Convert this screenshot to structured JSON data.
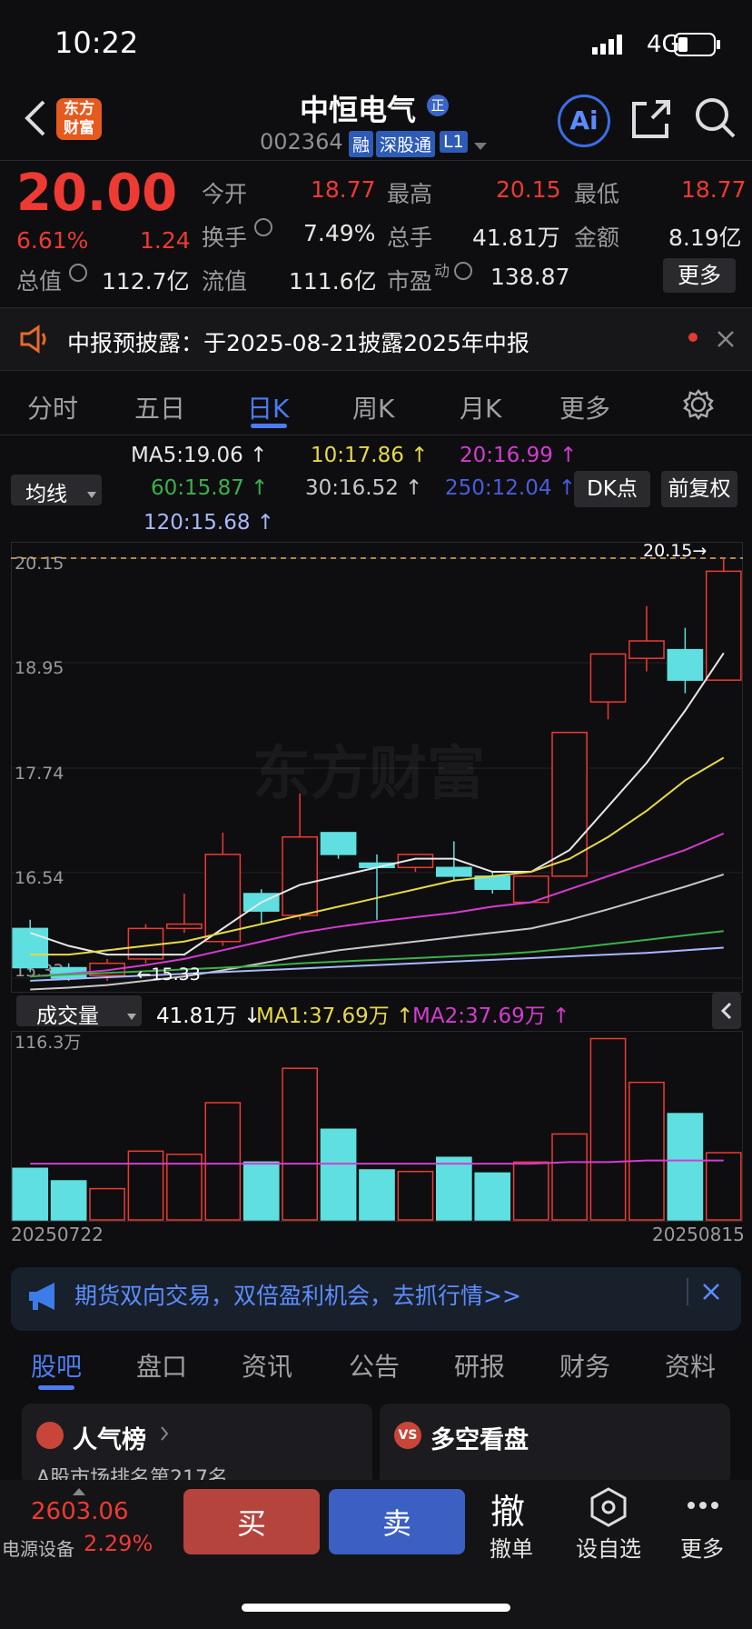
{
  "status": {
    "time": "10:22",
    "network": "4G"
  },
  "header": {
    "logo_text": "东方财富",
    "name": "中恒电气",
    "name_badge": "正",
    "code": "002364",
    "tags": [
      "融",
      "深股通",
      "L1"
    ],
    "ai_label": "Ai"
  },
  "quote": {
    "price": "20.00",
    "change_pct": "6.61%",
    "change_amt": "1.24",
    "rows": [
      [
        {
          "label": "今开",
          "value": "18.77"
        },
        {
          "label": "最高",
          "value": "20.15"
        },
        {
          "label": "最低",
          "value": "18.77"
        }
      ],
      [
        {
          "label": "换手",
          "value": "7.49%"
        },
        {
          "label": "总手",
          "value": "41.81万"
        },
        {
          "label": "金额",
          "value": "8.19亿"
        }
      ],
      [
        {
          "label": "总值",
          "value": "112.7亿"
        },
        {
          "label": "流值",
          "value": "111.6亿"
        },
        {
          "label": "市盈",
          "value": "138.87",
          "sup": "动"
        }
      ]
    ],
    "more_label": "更多"
  },
  "notice": {
    "text": "中报预披露：于2025-08-21披露2025年中报"
  },
  "ktabs": [
    "分时",
    "五日",
    "日K",
    "周K",
    "月K",
    "更多"
  ],
  "ktabs_active": 2,
  "ma": {
    "selector": "均线",
    "items": [
      {
        "label": "MA5:19.06 ↑",
        "color": "#e8e8e8"
      },
      {
        "label": "10:17.86 ↑",
        "color": "#e8d84a"
      },
      {
        "label": "20:16.99 ↑",
        "color": "#d43cd0"
      },
      {
        "label": "60:15.87 ↑",
        "color": "#3cb04a"
      },
      {
        "label": "30:16.52 ↑",
        "color": "#c8c8c8"
      },
      {
        "label": "250:12.04 ↑",
        "color": "#4a5ce0"
      },
      {
        "label": "120:15.68 ↑",
        "color": "#a9b8ff"
      }
    ],
    "dk_label": "DK点",
    "adj_label": "前复权"
  },
  "chart_data": {
    "type": "candlestick",
    "y_ticks": [
      "20.15",
      "18.95",
      "17.74",
      "16.54",
      "15.33"
    ],
    "ylim": [
      15.33,
      20.15
    ],
    "high_marker": "20.15",
    "low_marker": "15.33",
    "watermark": "东方财富",
    "candles": [
      {
        "o": 15.9,
        "c": 15.45,
        "h": 16.0,
        "l": 15.4
      },
      {
        "o": 15.45,
        "c": 15.33,
        "h": 15.5,
        "l": 15.3
      },
      {
        "o": 15.36,
        "c": 15.5,
        "h": 15.55,
        "l": 15.3
      },
      {
        "o": 15.55,
        "c": 15.9,
        "h": 15.95,
        "l": 15.5
      },
      {
        "o": 15.9,
        "c": 15.95,
        "h": 16.3,
        "l": 15.85
      },
      {
        "o": 15.75,
        "c": 16.75,
        "h": 17.0,
        "l": 15.7
      },
      {
        "o": 16.3,
        "c": 16.1,
        "h": 16.35,
        "l": 15.95
      },
      {
        "o": 16.05,
        "c": 16.95,
        "h": 17.45,
        "l": 16.0
      },
      {
        "o": 17.0,
        "c": 16.75,
        "h": 17.0,
        "l": 16.7
      },
      {
        "o": 16.65,
        "c": 16.6,
        "h": 16.75,
        "l": 16.0
      },
      {
        "o": 16.6,
        "c": 16.75,
        "h": 16.75,
        "l": 16.55
      },
      {
        "o": 16.6,
        "c": 16.5,
        "h": 16.9,
        "l": 16.45
      },
      {
        "o": 16.5,
        "c": 16.35,
        "h": 16.55,
        "l": 16.3
      },
      {
        "o": 16.2,
        "c": 16.5,
        "h": 16.5,
        "l": 16.2
      },
      {
        "o": 16.5,
        "c": 18.15,
        "h": 18.15,
        "l": 16.5
      },
      {
        "o": 18.5,
        "c": 19.05,
        "h": 19.05,
        "l": 18.3
      },
      {
        "o": 19.0,
        "c": 19.2,
        "h": 19.6,
        "l": 18.85
      },
      {
        "o": 19.1,
        "c": 18.75,
        "h": 19.35,
        "l": 18.6
      },
      {
        "o": 18.75,
        "c": 20.0,
        "h": 20.15,
        "l": 18.75
      }
    ],
    "ma_lines": {
      "MA5": {
        "color": "#e8e8e8",
        "values": [
          15.85,
          15.7,
          15.6,
          15.6,
          15.6,
          15.9,
          16.2,
          16.4,
          16.5,
          16.6,
          16.7,
          16.7,
          16.55,
          16.55,
          16.8,
          17.3,
          17.8,
          18.4,
          19.06
        ]
      },
      "MA10": {
        "color": "#e8d84a",
        "values": [
          15.6,
          15.6,
          15.65,
          15.7,
          15.75,
          15.85,
          15.95,
          16.05,
          16.15,
          16.25,
          16.35,
          16.45,
          16.5,
          16.55,
          16.7,
          16.95,
          17.25,
          17.6,
          17.86
        ]
      },
      "MA20": {
        "color": "#d43cd0",
        "values": [
          15.35,
          15.38,
          15.42,
          15.48,
          15.55,
          15.65,
          15.75,
          15.85,
          15.92,
          15.98,
          16.03,
          16.08,
          16.15,
          16.2,
          16.35,
          16.5,
          16.65,
          16.8,
          16.99
        ]
      },
      "MA30": {
        "color": "#c8c8c8",
        "values": [
          15.2,
          15.22,
          15.25,
          15.3,
          15.35,
          15.42,
          15.5,
          15.58,
          15.65,
          15.7,
          15.75,
          15.8,
          15.85,
          15.9,
          16.0,
          16.12,
          16.25,
          16.38,
          16.52
        ]
      },
      "MA60": {
        "color": "#3cb04a",
        "values": [
          15.35,
          15.37,
          15.39,
          15.41,
          15.43,
          15.45,
          15.47,
          15.5,
          15.52,
          15.54,
          15.56,
          15.58,
          15.6,
          15.63,
          15.67,
          15.72,
          15.77,
          15.82,
          15.87
        ]
      },
      "MA120": {
        "color": "#a9b8ff",
        "values": [
          15.3,
          15.32,
          15.34,
          15.36,
          15.38,
          15.4,
          15.42,
          15.44,
          15.46,
          15.48,
          15.5,
          15.52,
          15.54,
          15.56,
          15.58,
          15.6,
          15.62,
          15.65,
          15.68
        ]
      }
    },
    "volume": {
      "selector": "成交量",
      "current": "41.81万 ↓",
      "ma1": "MA1:37.69万 ↑",
      "ma2": "MA2:37.69万 ↑",
      "max_label": "116.3万",
      "max": 116.3,
      "values": [
        33,
        25,
        20,
        44,
        42,
        75,
        37,
        97,
        58,
        32,
        31,
        40,
        30,
        37,
        55,
        116,
        88,
        68,
        43
      ],
      "ma_values": [
        36,
        36,
        36,
        36,
        36,
        36,
        36,
        36,
        36,
        36,
        36,
        36,
        36,
        36,
        37,
        37,
        38,
        38,
        38
      ],
      "start_date": "20250722",
      "end_date": "20250815"
    }
  },
  "ad": {
    "text": "期货双向交易，双倍盈利机会，去抓行情>>"
  },
  "btabs": [
    "股吧",
    "盘口",
    "资讯",
    "公告",
    "研报",
    "财务",
    "资料"
  ],
  "btabs_active": 0,
  "cards": [
    {
      "title": "人气榜",
      "sub": "A股市场排名第217名"
    },
    {
      "title": "多空看盘"
    }
  ],
  "bottom": {
    "index_value": "2603.06",
    "index_name": "电源设备",
    "index_pct": "2.29%",
    "buy": "买",
    "sell": "卖",
    "cancel_icon": "撤",
    "cancel": "撤单",
    "watch": "设自选",
    "more": "更多"
  }
}
